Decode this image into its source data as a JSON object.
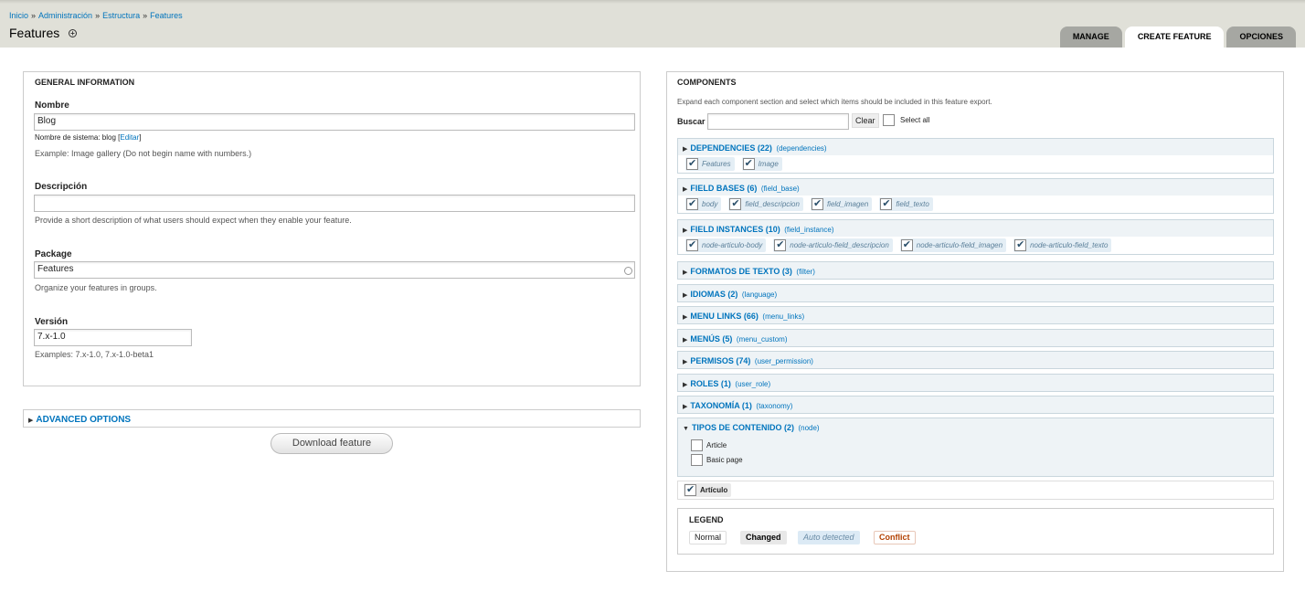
{
  "breadcrumb": [
    "Inicio",
    "Administración",
    "Estructura",
    "Features"
  ],
  "breadcrumb_sep": "»",
  "page_title": "Features",
  "title_plus": "+",
  "tabs": [
    {
      "label": "MANAGE",
      "active": false
    },
    {
      "label": "CREATE FEATURE",
      "active": true
    },
    {
      "label": "OPCIONES",
      "active": false
    }
  ],
  "general": {
    "legend": "GENERAL INFORMATION",
    "nombre_label": "Nombre",
    "nombre_value": "Blog",
    "machine_prefix": "Nombre de sistema: blog [",
    "machine_edit": "Editar",
    "machine_suffix": "]",
    "nombre_desc": "Example: Image gallery (Do not begin name with numbers.)",
    "descripcion_label": "Descripción",
    "descripcion_value": "",
    "descripcion_desc": "Provide a short description of what users should expect when they enable your feature.",
    "package_label": "Package",
    "package_value": "Features",
    "package_desc": "Organize your features in groups.",
    "version_label": "Versión",
    "version_value": "7.x-1.0",
    "version_desc": "Examples: 7.x-1.0, 7.x-1.0-beta1"
  },
  "advanced": {
    "label": "ADVANCED OPTIONS"
  },
  "download_label": "Download feature",
  "components": {
    "legend": "COMPONENTS",
    "desc": "Expand each component section and select which items should be included in this feature export.",
    "buscar_label": "Buscar",
    "buscar_value": "",
    "clear_label": "Clear",
    "select_all_label": "Select all",
    "sections": [
      {
        "name": "DEPENDENCIES (22)",
        "machine": "(dependencies)",
        "items": [
          "Features",
          "Image"
        ]
      },
      {
        "name": "FIELD BASES (6)",
        "machine": "(field_base)",
        "items": [
          "body",
          "field_descripcion",
          "field_imagen",
          "field_texto"
        ]
      },
      {
        "name": "FIELD INSTANCES (10)",
        "machine": "(field_instance)",
        "items": [
          "node-articulo-body",
          "node-articulo-field_descripcion",
          "node-articulo-field_imagen",
          "node-articulo-field_texto"
        ]
      },
      {
        "name": "FORMATOS DE TEXTO (3)",
        "machine": "(filter)",
        "items": []
      },
      {
        "name": "IDIOMAS (2)",
        "machine": "(language)",
        "items": []
      },
      {
        "name": "MENU LINKS (66)",
        "machine": "(menu_links)",
        "items": []
      },
      {
        "name": "MENÚS (5)",
        "machine": "(menu_custom)",
        "items": []
      },
      {
        "name": "PERMISOS (74)",
        "machine": "(user_permission)",
        "items": []
      },
      {
        "name": "ROLES (1)",
        "machine": "(user_role)",
        "items": []
      },
      {
        "name": "TAXONOMÍA (1)",
        "machine": "(taxonomy)",
        "items": []
      },
      {
        "name": "TIPOS DE CONTENIDO (2)",
        "machine": "(node)",
        "items": []
      }
    ],
    "node_options": [
      "Article",
      "Basic page"
    ],
    "node_selected": "Artículo"
  },
  "legend_box": {
    "title": "LEGEND",
    "normal": "Normal",
    "changed": "Changed",
    "auto": "Auto detected",
    "conflict": "Conflict"
  },
  "colors": {
    "link": "#0074bd",
    "header_bg": "#e0e0d8",
    "tab_bg": "#a6a7a2",
    "section_bg": "#eef3f6",
    "conflict": "#b34000",
    "auto_bg": "#dceaf5"
  }
}
